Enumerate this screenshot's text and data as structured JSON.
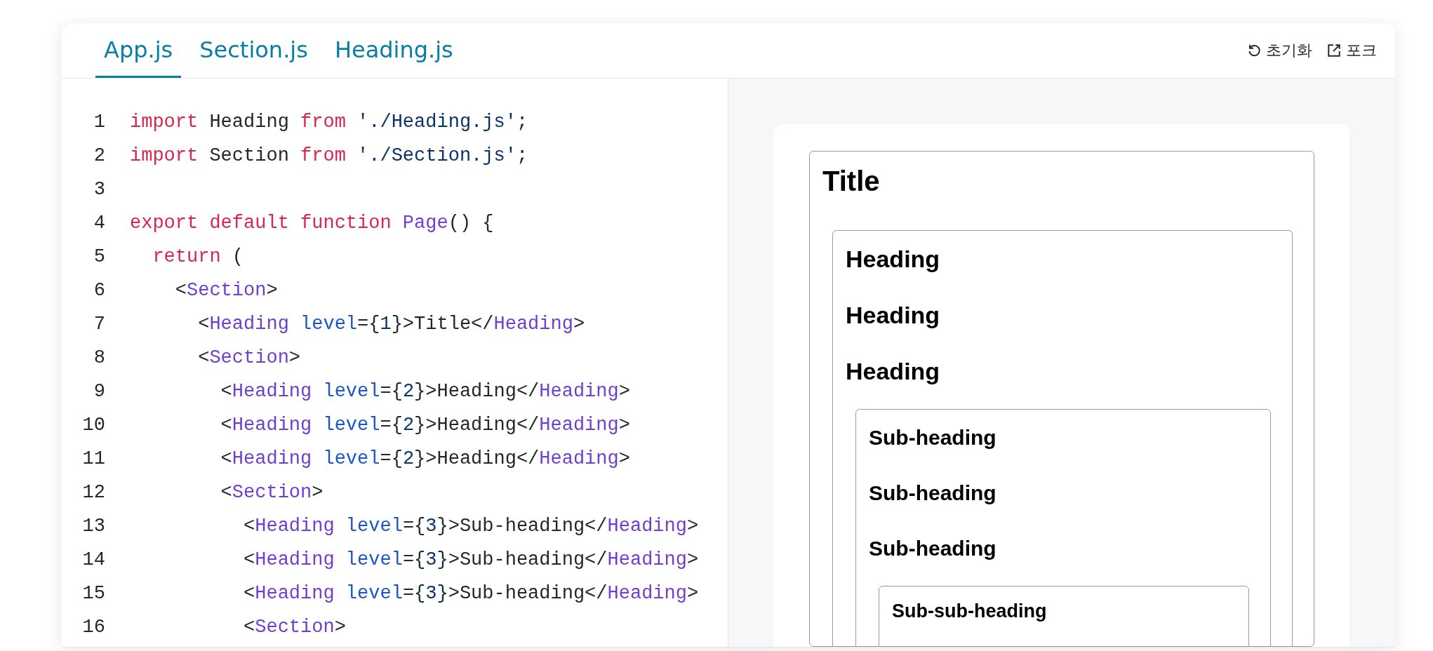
{
  "tabs": [
    {
      "label": "App.js",
      "selected": true
    },
    {
      "label": "Section.js",
      "selected": false
    },
    {
      "label": "Heading.js",
      "selected": false
    }
  ],
  "actions": [
    {
      "label": "초기화",
      "kind": "reset"
    },
    {
      "label": "포크",
      "kind": "fork"
    }
  ],
  "code": {
    "lines": [
      {
        "number": "1",
        "tokens": [
          {
            "kind": "keyword",
            "text": "import"
          },
          {
            "kind": "plain",
            "text": " Heading "
          },
          {
            "kind": "keyword",
            "text": "from"
          },
          {
            "kind": "string",
            "text": " './Heading.js'"
          },
          {
            "kind": "plain",
            "text": ";"
          }
        ]
      },
      {
        "number": "2",
        "tokens": [
          {
            "kind": "keyword",
            "text": "import"
          },
          {
            "kind": "plain",
            "text": " Section "
          },
          {
            "kind": "keyword",
            "text": "from"
          },
          {
            "kind": "string",
            "text": " './Section.js'"
          },
          {
            "kind": "plain",
            "text": ";"
          }
        ]
      },
      {
        "number": "3"
      },
      {
        "number": "4",
        "tokens": [
          {
            "kind": "keyword",
            "text": "export default function"
          },
          {
            "kind": "component",
            "text": " Page"
          },
          {
            "kind": "plain",
            "text": "() {"
          }
        ]
      },
      {
        "number": "5",
        "tokens": [
          {
            "kind": "keyword",
            "text": "  return"
          },
          {
            "kind": "plain",
            "text": " ("
          }
        ]
      },
      {
        "number": "6",
        "tokens": [
          {
            "kind": "plain",
            "text": "    <"
          },
          {
            "kind": "component",
            "text": "Section"
          },
          {
            "kind": "plain",
            "text": ">"
          }
        ]
      },
      {
        "number": "7",
        "tokens": [
          {
            "kind": "plain",
            "text": "      <"
          },
          {
            "kind": "component",
            "text": "Heading"
          },
          {
            "kind": "attr",
            "text": " level"
          },
          {
            "kind": "plain",
            "text": "={"
          },
          {
            "kind": "number",
            "text": "1"
          },
          {
            "kind": "plain",
            "text": "}>Title</"
          },
          {
            "kind": "component",
            "text": "Heading"
          },
          {
            "kind": "plain",
            "text": ">"
          }
        ]
      },
      {
        "number": "8",
        "tokens": [
          {
            "kind": "plain",
            "text": "      <"
          },
          {
            "kind": "component",
            "text": "Section"
          },
          {
            "kind": "plain",
            "text": ">"
          }
        ]
      },
      {
        "number": "9",
        "tokens": [
          {
            "kind": "plain",
            "text": "        <"
          },
          {
            "kind": "component",
            "text": "Heading"
          },
          {
            "kind": "attr",
            "text": " level"
          },
          {
            "kind": "plain",
            "text": "={"
          },
          {
            "kind": "number",
            "text": "2"
          },
          {
            "kind": "plain",
            "text": "}>Heading</"
          },
          {
            "kind": "component",
            "text": "Heading"
          },
          {
            "kind": "plain",
            "text": ">"
          }
        ]
      },
      {
        "number": "10",
        "tokens": [
          {
            "kind": "plain",
            "text": "        <"
          },
          {
            "kind": "component",
            "text": "Heading"
          },
          {
            "kind": "attr",
            "text": " level"
          },
          {
            "kind": "plain",
            "text": "={"
          },
          {
            "kind": "number",
            "text": "2"
          },
          {
            "kind": "plain",
            "text": "}>Heading</"
          },
          {
            "kind": "component",
            "text": "Heading"
          },
          {
            "kind": "plain",
            "text": ">"
          }
        ]
      },
      {
        "number": "11",
        "tokens": [
          {
            "kind": "plain",
            "text": "        <"
          },
          {
            "kind": "component",
            "text": "Heading"
          },
          {
            "kind": "attr",
            "text": " level"
          },
          {
            "kind": "plain",
            "text": "={"
          },
          {
            "kind": "number",
            "text": "2"
          },
          {
            "kind": "plain",
            "text": "}>Heading</"
          },
          {
            "kind": "component",
            "text": "Heading"
          },
          {
            "kind": "plain",
            "text": ">"
          }
        ]
      },
      {
        "number": "12",
        "tokens": [
          {
            "kind": "plain",
            "text": "        <"
          },
          {
            "kind": "component",
            "text": "Section"
          },
          {
            "kind": "plain",
            "text": ">"
          }
        ]
      },
      {
        "number": "13",
        "tokens": [
          {
            "kind": "plain",
            "text": "          <"
          },
          {
            "kind": "component",
            "text": "Heading"
          },
          {
            "kind": "attr",
            "text": " level"
          },
          {
            "kind": "plain",
            "text": "={"
          },
          {
            "kind": "number",
            "text": "3"
          },
          {
            "kind": "plain",
            "text": "}>Sub-heading</"
          },
          {
            "kind": "component",
            "text": "Heading"
          },
          {
            "kind": "plain",
            "text": ">"
          }
        ]
      },
      {
        "number": "14",
        "tokens": [
          {
            "kind": "plain",
            "text": "          <"
          },
          {
            "kind": "component",
            "text": "Heading"
          },
          {
            "kind": "attr",
            "text": " level"
          },
          {
            "kind": "plain",
            "text": "={"
          },
          {
            "kind": "number",
            "text": "3"
          },
          {
            "kind": "plain",
            "text": "}>Sub-heading</"
          },
          {
            "kind": "component",
            "text": "Heading"
          },
          {
            "kind": "plain",
            "text": ">"
          }
        ]
      },
      {
        "number": "15",
        "tokens": [
          {
            "kind": "plain",
            "text": "          <"
          },
          {
            "kind": "component",
            "text": "Heading"
          },
          {
            "kind": "attr",
            "text": " level"
          },
          {
            "kind": "plain",
            "text": "={"
          },
          {
            "kind": "number",
            "text": "3"
          },
          {
            "kind": "plain",
            "text": "}>Sub-heading</"
          },
          {
            "kind": "component",
            "text": "Heading"
          },
          {
            "kind": "plain",
            "text": ">"
          }
        ]
      },
      {
        "number": "16",
        "tokens": [
          {
            "kind": "plain",
            "text": "          <"
          },
          {
            "kind": "component",
            "text": "Section"
          },
          {
            "kind": "plain",
            "text": ">"
          }
        ]
      }
    ]
  },
  "preview": {
    "section": {
      "headings": [
        {
          "kind": "h1",
          "text": "Title"
        }
      ],
      "section": {
        "headings": [
          {
            "kind": "h2",
            "text": "Heading"
          },
          {
            "kind": "h2",
            "text": "Heading"
          },
          {
            "kind": "h2",
            "text": "Heading"
          }
        ],
        "section": {
          "headings": [
            {
              "kind": "h3",
              "text": "Sub-heading"
            },
            {
              "kind": "h3",
              "text": "Sub-heading"
            },
            {
              "kind": "h3",
              "text": "Sub-heading"
            }
          ],
          "section": {
            "headings": [
              {
                "kind": "h4",
                "text": "Sub-sub-heading"
              }
            ]
          }
        }
      }
    }
  }
}
